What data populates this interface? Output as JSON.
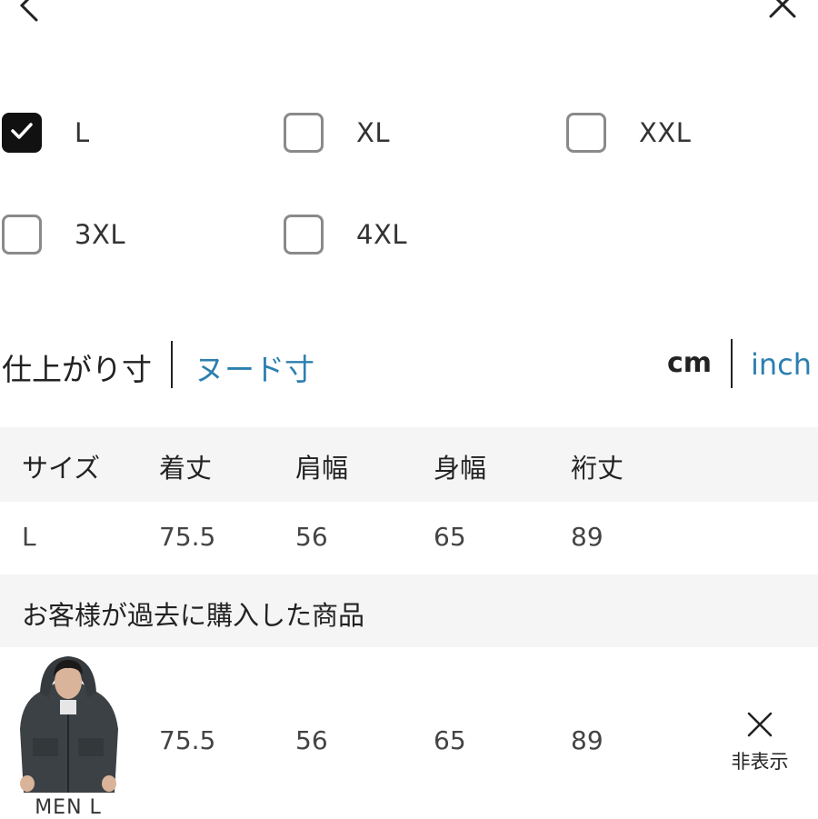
{
  "nav": {
    "back_icon": "chevron-left-icon",
    "close_icon": "close-icon"
  },
  "sizes": [
    {
      "label": "L",
      "checked": true
    },
    {
      "label": "XL",
      "checked": false
    },
    {
      "label": "XXL",
      "checked": false
    },
    {
      "label": "3XL",
      "checked": false
    },
    {
      "label": "4XL",
      "checked": false
    }
  ],
  "measure_toggle": {
    "finished": "仕上がり寸",
    "nude": "ヌード寸"
  },
  "unit_toggle": {
    "cm": "cm",
    "inch": "inch"
  },
  "colors": {
    "accent": "#2b7fb0",
    "checked_bg": "#111111",
    "row_shade": "#f5f5f5"
  },
  "table": {
    "headers": [
      "サイズ",
      "着丈",
      "肩幅",
      "身幅",
      "裄丈"
    ],
    "rows": [
      [
        "L",
        "75.5",
        "56",
        "65",
        "89"
      ]
    ]
  },
  "purchased": {
    "title": "お客様が過去に購入した商品",
    "item": {
      "label": "MEN L",
      "values": [
        "75.5",
        "56",
        "65",
        "89"
      ],
      "hide_label": "非表示",
      "hide_icon": "close-icon"
    }
  }
}
